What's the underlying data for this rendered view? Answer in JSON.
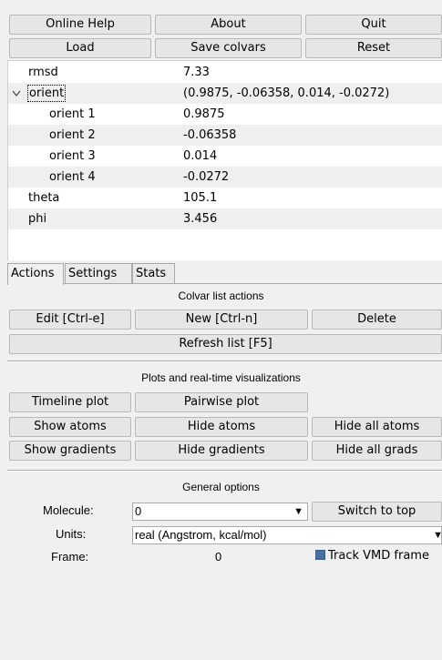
{
  "top_buttons": {
    "online_help": "Online Help",
    "about": "About",
    "quit": "Quit",
    "load": "Load",
    "save_colvars": "Save colvars",
    "reset": "Reset"
  },
  "tree": {
    "rows": [
      {
        "name": "rmsd",
        "value": "7.33"
      },
      {
        "name": "orient",
        "value": "(0.9875, -0.06358, 0.014, -0.0272)"
      },
      {
        "name": "orient 1",
        "value": "0.9875"
      },
      {
        "name": "orient 2",
        "value": "-0.06358"
      },
      {
        "name": "orient 3",
        "value": "0.014"
      },
      {
        "name": "orient 4",
        "value": "-0.0272"
      },
      {
        "name": "theta",
        "value": "105.1"
      },
      {
        "name": "phi",
        "value": "3.456"
      }
    ]
  },
  "tabs": [
    "Actions",
    "Settings",
    "Stats"
  ],
  "actions": {
    "colvar_section": "Colvar list actions",
    "edit": "Edit [Ctrl-e]",
    "new": "New [Ctrl-n]",
    "delete": "Delete",
    "refresh": "Refresh list [F5]",
    "plots_section": "Plots and real-time visualizations",
    "timeline_plot": "Timeline plot",
    "pairwise_plot": "Pairwise plot",
    "show_atoms": "Show atoms",
    "hide_atoms": "Hide atoms",
    "hide_all_atoms": "Hide all atoms",
    "show_gradients": "Show gradients",
    "hide_gradients": "Hide gradients",
    "hide_all_grads": "Hide all grads",
    "general_section": "General options"
  },
  "options": {
    "molecule_label": "Molecule:",
    "molecule_value": "0",
    "switch_to_top": "Switch to top",
    "units_label": "Units:",
    "units_value": "real (Angstrom, kcal/mol)",
    "frame_label": "Frame:",
    "frame_value": "0",
    "track_vmd_frame": "Track VMD frame",
    "track_checked": true
  },
  "icons": {
    "expand": "chevron-down-icon",
    "dropdown": "dropdown-arrow-icon"
  },
  "colors": {
    "check_fill": "#4a6fa5"
  }
}
